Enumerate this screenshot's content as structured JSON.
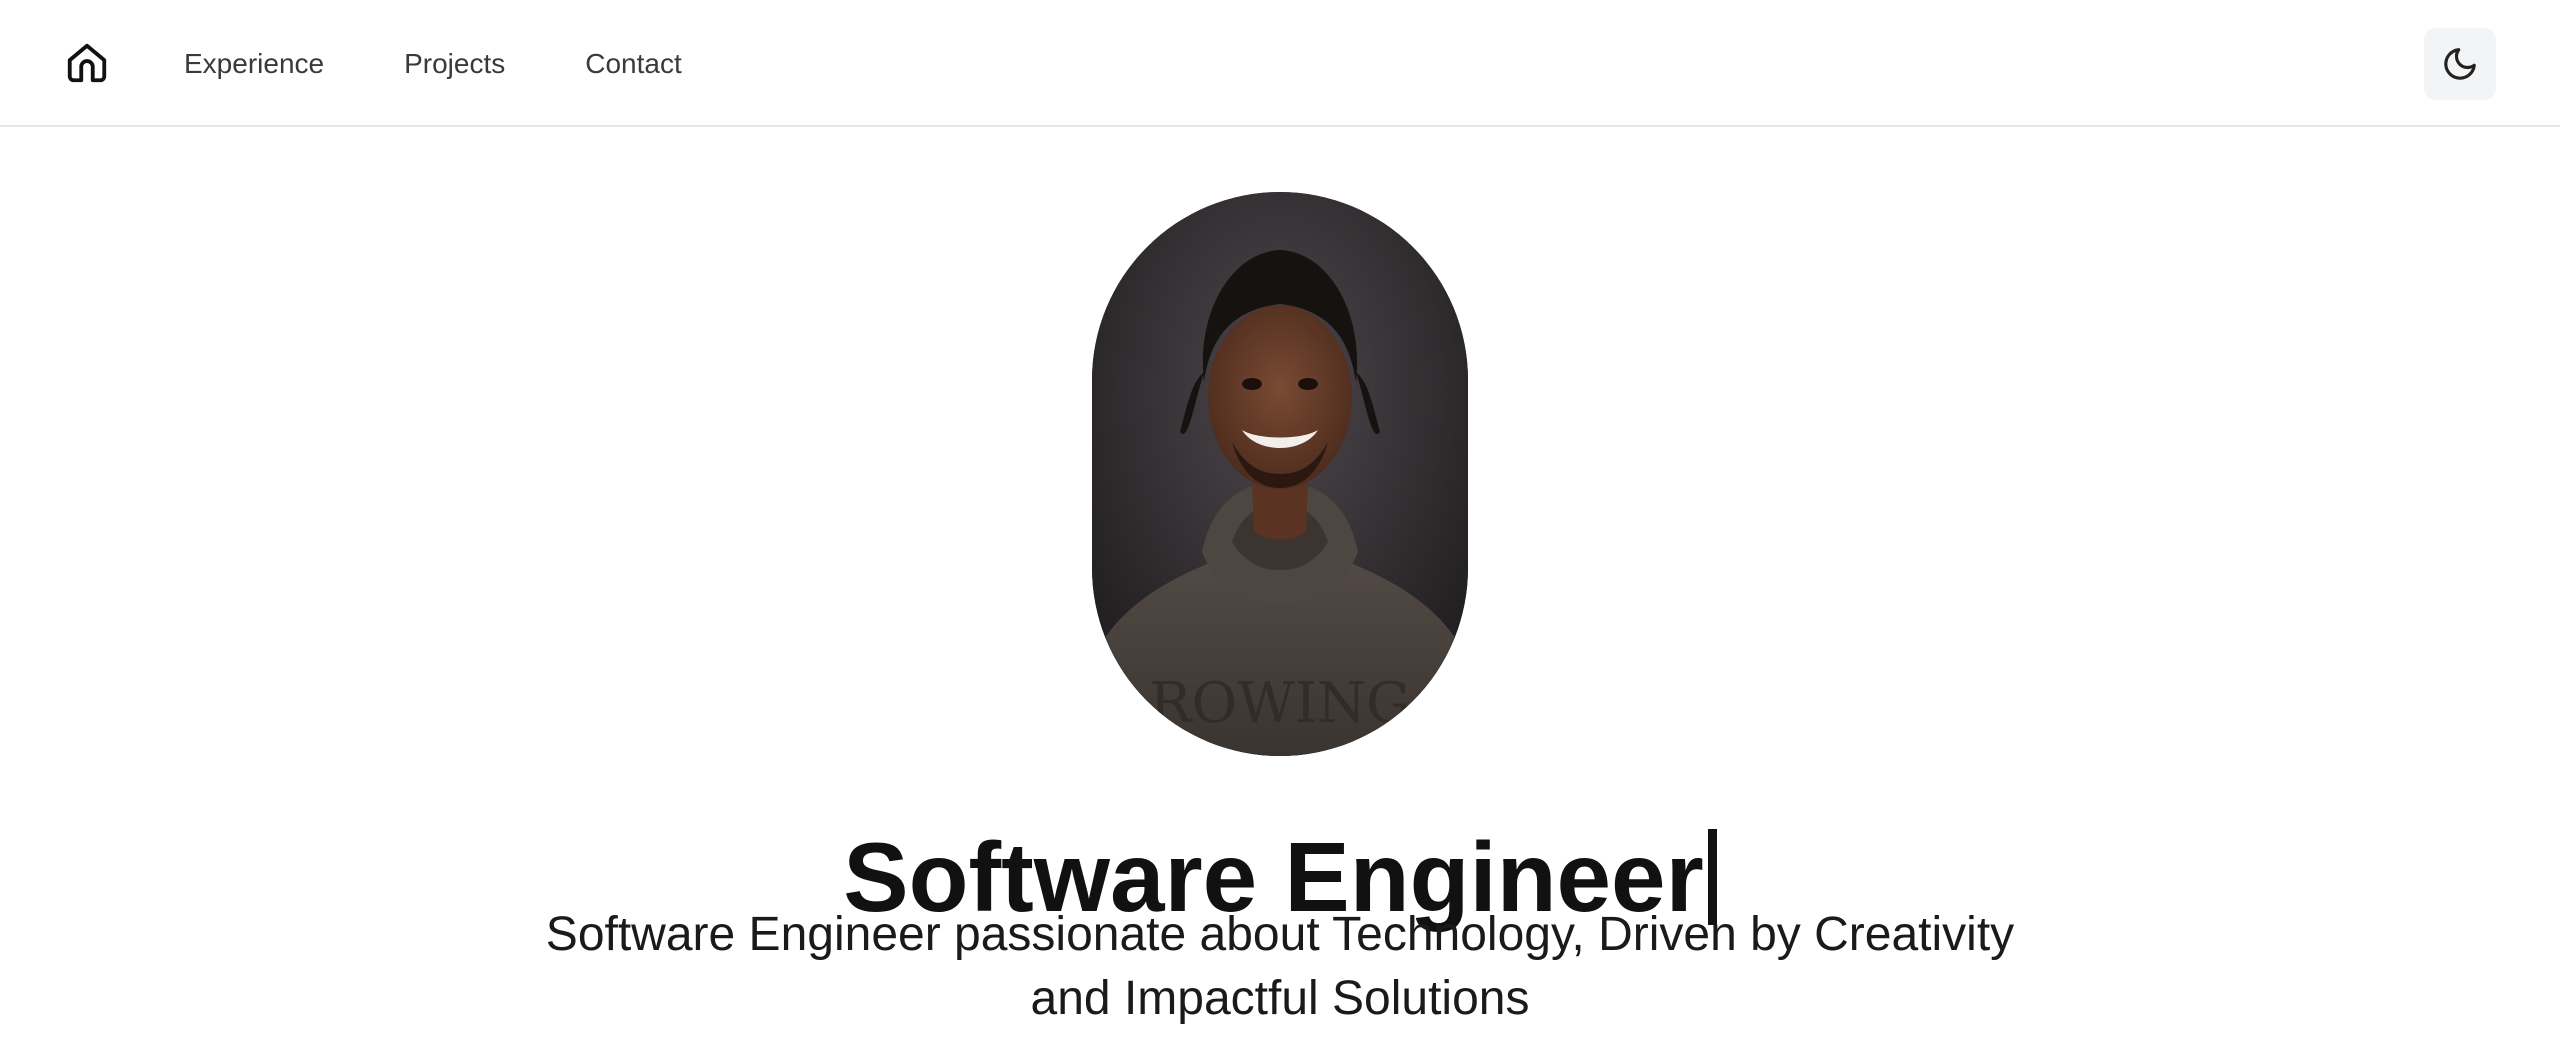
{
  "nav": {
    "home_icon": "home-icon",
    "links": [
      {
        "label": "Experience"
      },
      {
        "label": "Projects"
      },
      {
        "label": "Contact"
      }
    ],
    "theme_toggle_icon": "moon-icon"
  },
  "hero": {
    "avatar_description_icon": "profile-photo",
    "title": "Software Engineer",
    "subtitle_line1": "Software Engineer passionate about Technology, Driven by Creativity",
    "subtitle_line2": "and Impactful Solutions"
  },
  "colors": {
    "text": "#111111",
    "nav_text": "#3a3a3a",
    "toggle_bg": "#f3f4f6",
    "divider": "#e6e6e6"
  }
}
